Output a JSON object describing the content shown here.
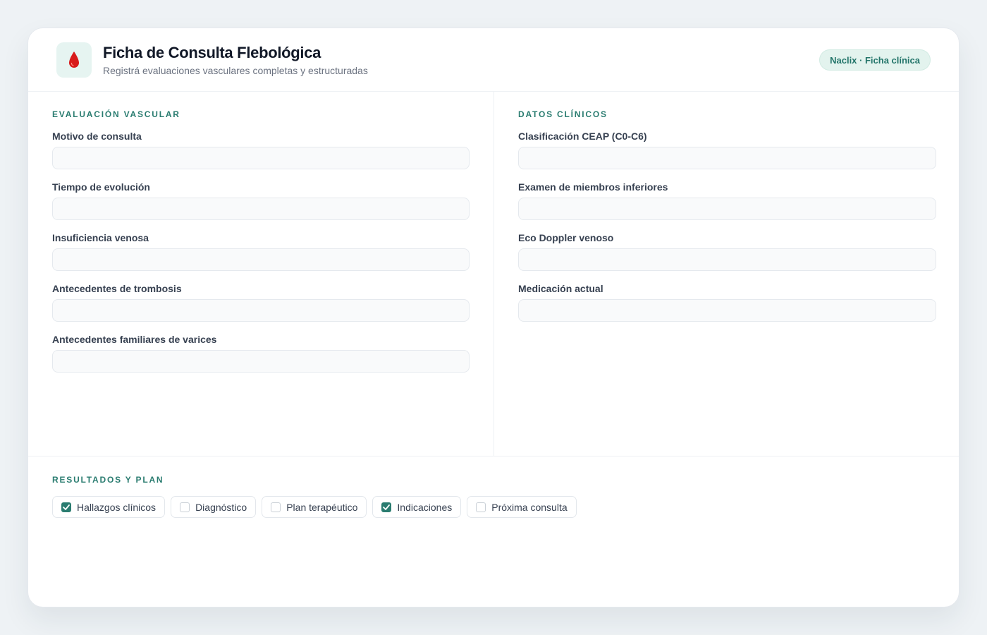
{
  "header": {
    "title": "Ficha de Consulta Flebológica",
    "subtitle": "Registrá evaluaciones vasculares completas y estructuradas",
    "badge": "Naclix · Ficha clínica",
    "logo_icon": "blood-drop-icon"
  },
  "left": {
    "section_title": "Evaluación vascular",
    "fields": [
      {
        "label": "Motivo de consulta",
        "value": ""
      },
      {
        "label": "Tiempo de evolución",
        "value": ""
      },
      {
        "label": "Insuficiencia venosa",
        "value": ""
      },
      {
        "label": "Antecedentes de trombosis",
        "value": ""
      },
      {
        "label": "Antecedentes familiares de varices",
        "value": ""
      }
    ]
  },
  "right": {
    "section_title": "Datos clínicos",
    "fields": [
      {
        "label": "Clasificación CEAP (C0-C6)",
        "value": ""
      },
      {
        "label": "Examen de miembros inferiores",
        "value": ""
      },
      {
        "label": "Eco Doppler venoso",
        "value": ""
      },
      {
        "label": "Medicación actual",
        "value": ""
      }
    ]
  },
  "results": {
    "section_title": "Resultados y plan",
    "options": [
      {
        "label": "Hallazgos clínicos",
        "checked": true
      },
      {
        "label": "Diagnóstico",
        "checked": false
      },
      {
        "label": "Plan terapéutico",
        "checked": false
      },
      {
        "label": "Indicaciones",
        "checked": true
      },
      {
        "label": "Próxima consulta",
        "checked": false
      }
    ]
  },
  "colors": {
    "accent": "#2a7c70",
    "drop": "#d81b1b",
    "badge_bg": "#e3f3ee"
  }
}
